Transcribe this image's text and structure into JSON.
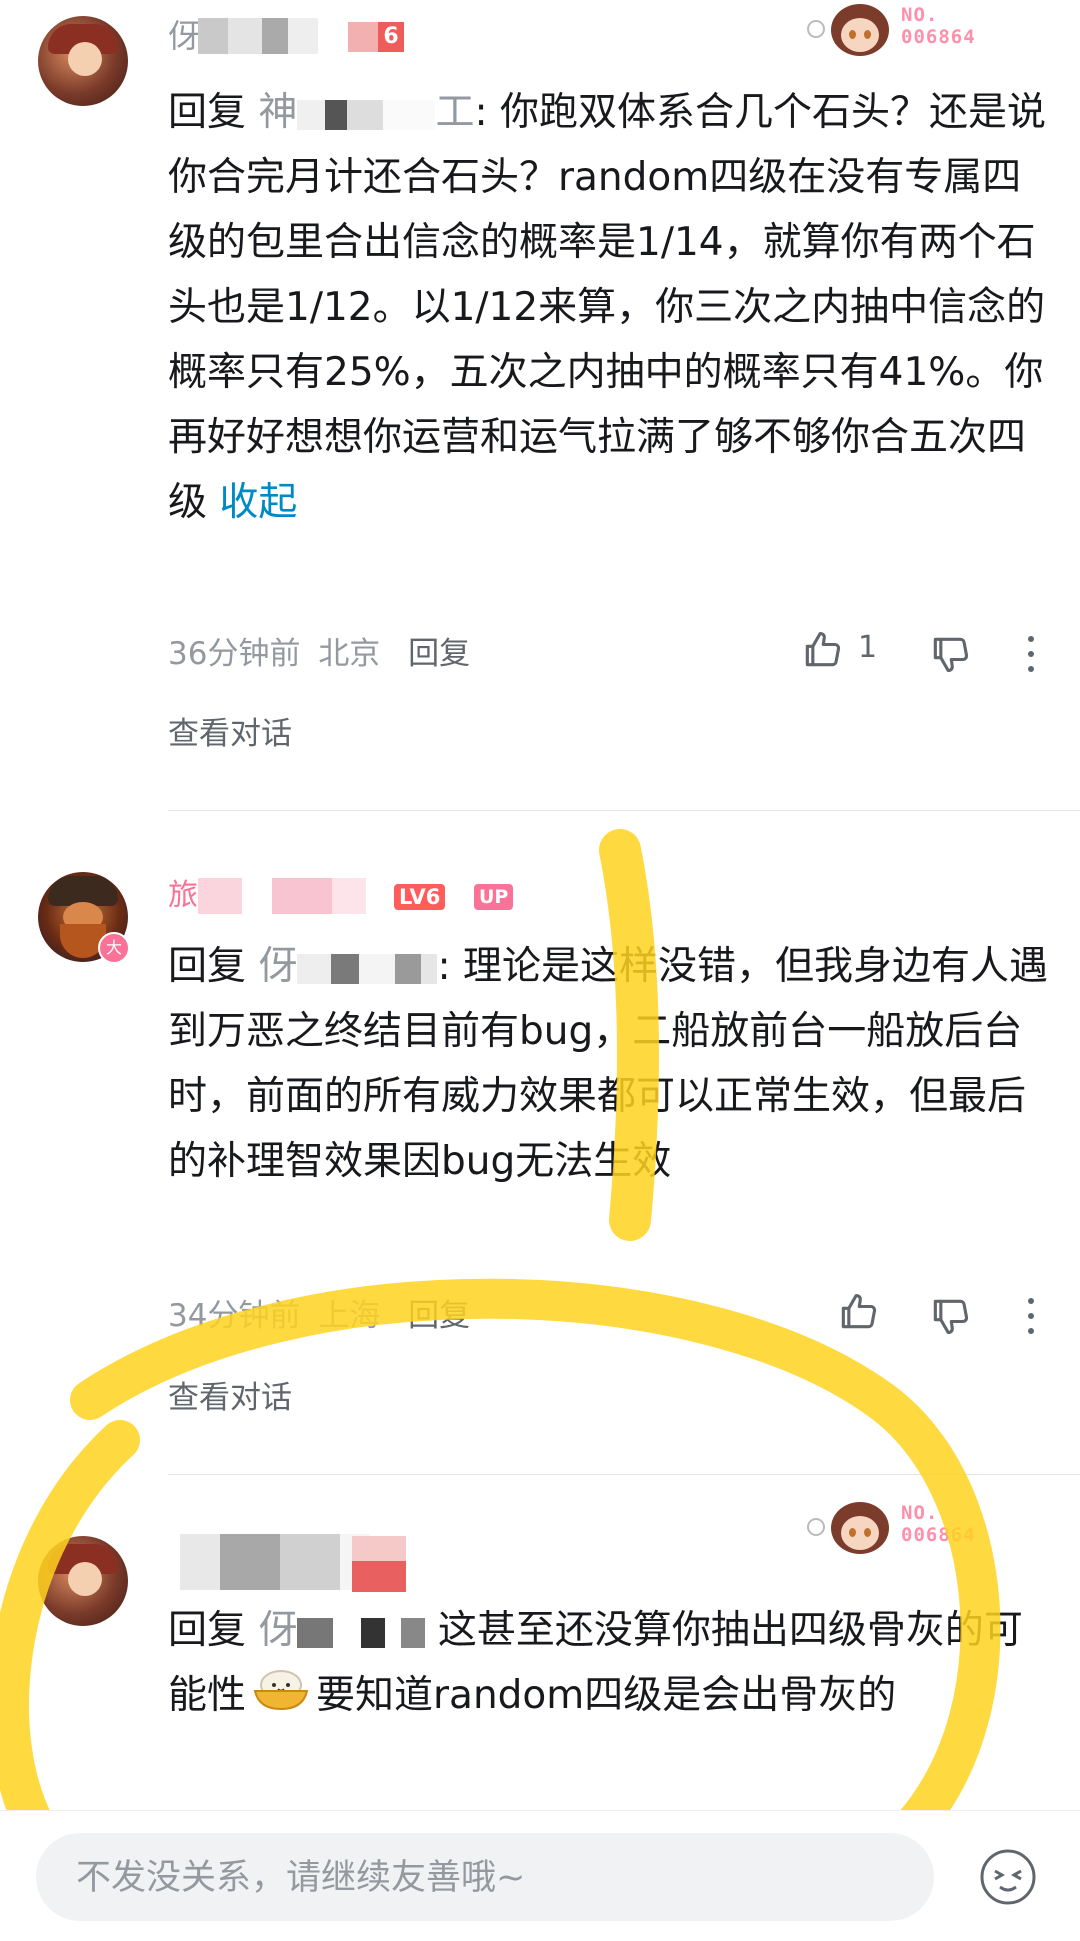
{
  "comments": [
    {
      "name_prefix": "伢",
      "level": "6",
      "reply_prefix": "回复",
      "reply_target": "神",
      "reply_target_suffix": "工",
      "text": ": 你跑双体系合几个石头？还是说你合完月计还合石头？random四级在没有专属四级的包里合出信念的概率是1/14，就算你有两个石头也是1/12。以1/12来算，你三次之内抽中信念的概率只有25%，五次之内抽中的概率只有41%。你再好好想想你运营和运气拉满了够不够你合五次四级",
      "collapse": "收起",
      "time": "36分钟前",
      "location": "北京",
      "reply": "回复",
      "likes": "1",
      "view_conversation": "查看对话",
      "nft_no": "NO.",
      "nft_id": "006864"
    },
    {
      "name_prefix": "旅",
      "level": "LV6",
      "up_badge": "UP",
      "avatar_badge": "大",
      "reply_prefix": "回复",
      "reply_target": "伢",
      "text": ": 理论是这样没错，但我身边有人遇到万恶之终结目前有bug，二船放前台一船放后台时，前面的所有威力效果都可以正常生效，但最后的补理智效果因bug无法生效",
      "time": "34分钟前",
      "location": "上海",
      "reply": "回复",
      "view_conversation": "查看对话"
    },
    {
      "reply_prefix": "回复",
      "reply_target": "伢",
      "text_1": "这甚至还没算你抽出四级骨灰的可能性",
      "text_2": "要知道random四级是会出骨灰的",
      "nft_no": "NO.",
      "nft_id": "006864"
    }
  ],
  "input": {
    "placeholder": "不发没关系，请继续友善哦~"
  },
  "icons": {
    "like": "thumbs-up-icon",
    "dislike": "thumbs-down-icon",
    "more": "more-vertical-icon",
    "emoji": "emoji-face-icon",
    "sticker": "bowl-emoji-icon"
  },
  "colors": {
    "accent": "#fb7299",
    "link": "#008ac5",
    "highlight": "#ffd21f"
  }
}
